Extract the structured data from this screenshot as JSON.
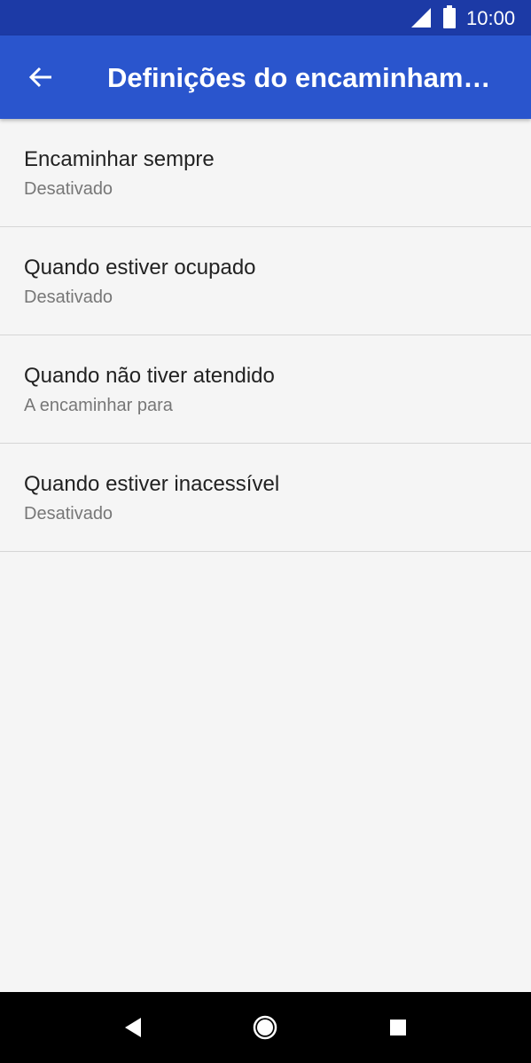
{
  "status_bar": {
    "time": "10:00",
    "icons": [
      "signal-icon",
      "battery-icon"
    ],
    "background_color": "#1c3aa6"
  },
  "app_bar": {
    "title": "Definições do encaminham…",
    "back_icon": "arrow-back-icon",
    "background_color": "#2a55cd"
  },
  "forwarding_options": [
    {
      "label": "Encaminhar sempre",
      "status": "Desativado"
    },
    {
      "label": "Quando estiver ocupado",
      "status": "Desativado"
    },
    {
      "label": "Quando não tiver atendido",
      "status": "A encaminhar para"
    },
    {
      "label": "Quando estiver inacessível",
      "status": "Desativado"
    }
  ],
  "navigation_bar": {
    "icons": [
      "back-triangle-icon",
      "home-circle-icon",
      "recents-square-icon"
    ]
  }
}
